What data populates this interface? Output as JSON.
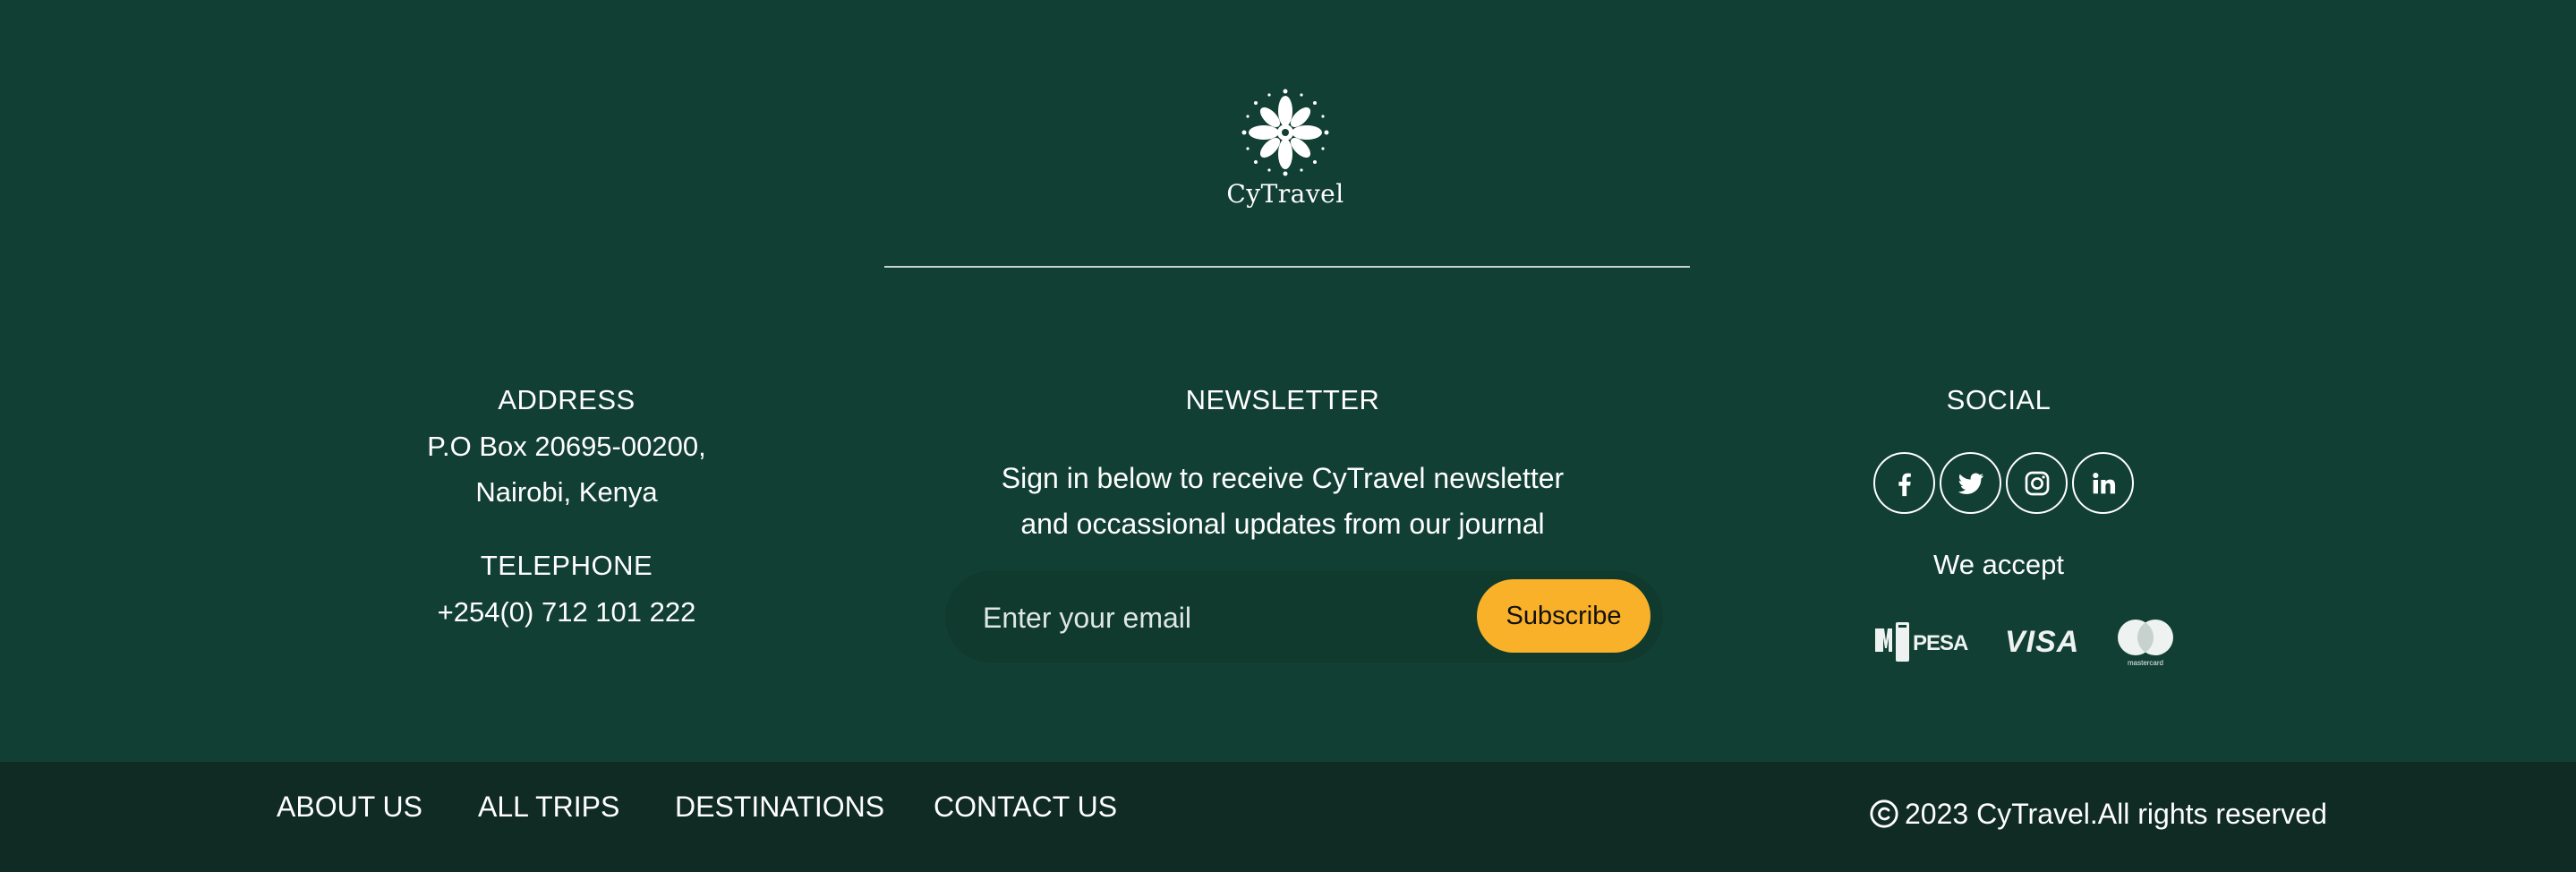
{
  "brand": {
    "name": "CyTravel",
    "logo_icon": "lotus-mandala-icon"
  },
  "address": {
    "heading": "ADDRESS",
    "line1": "P.O Box 20695-00200,",
    "line2": "Nairobi, Kenya"
  },
  "telephone": {
    "heading": "TELEPHONE",
    "number": "+254(0) 712 101 222"
  },
  "newsletter": {
    "heading": "NEWSLETTER",
    "description_line1": "Sign in below to receive CyTravel newsletter",
    "description_line2": "and occassional updates from our journal",
    "email_placeholder": "Enter your email",
    "subscribe_label": "Subscribe"
  },
  "social": {
    "heading": "SOCIAL",
    "icons": [
      "facebook-icon",
      "twitter-icon",
      "instagram-icon",
      "linkedin-icon"
    ],
    "accept_label": "We accept",
    "payment_methods": [
      "mpesa-logo",
      "visa-logo",
      "mastercard-logo"
    ]
  },
  "bottom_nav": {
    "links": [
      "ABOUT US",
      "ALL TRIPS",
      "DESTINATIONS",
      "CONTACT US"
    ],
    "copyright": "2023 CyTravel.All rights reserved",
    "copyright_icon": "copyright-icon"
  },
  "colors": {
    "footer_background": "#123f33",
    "bottom_bar_background": "#0f2b23",
    "input_background": "#0f3a2d",
    "subscribe_button": "#f9b129",
    "divider": "#c9d3cf"
  }
}
